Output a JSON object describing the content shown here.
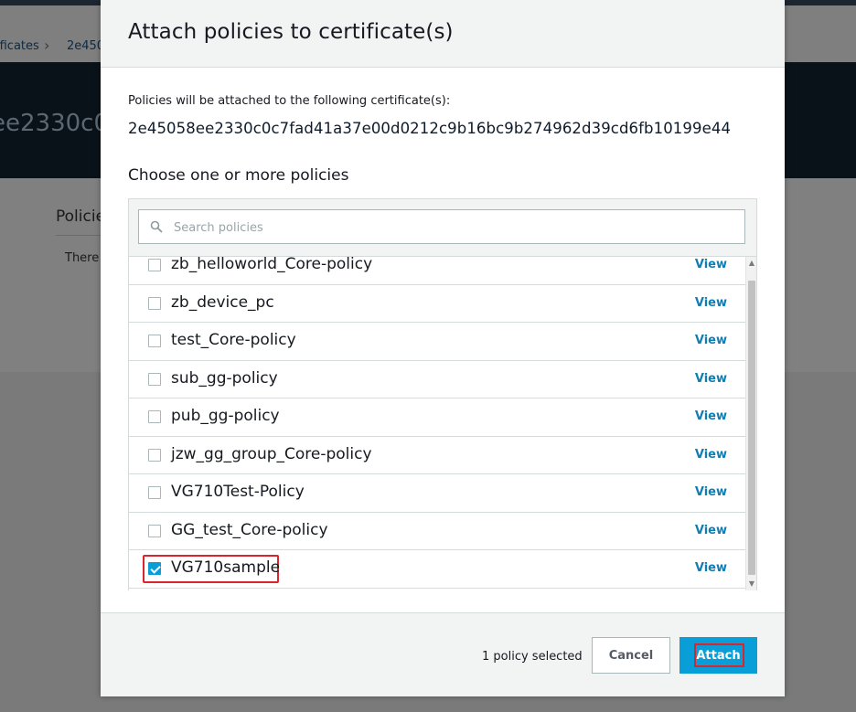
{
  "background": {
    "breadcrumb": [
      "ificates",
      "2e450"
    ],
    "banner_title": "ee2330c0c",
    "section_title": "Policie",
    "section_text": "There"
  },
  "modal": {
    "title": "Attach policies to certificate(s)",
    "cert_label": "Policies will be attached to the following certificate(s):",
    "cert_id": "2e45058ee2330c0c7fad41a37e00d0212c9b16bc9b274962d39cd6fb10199e44",
    "choose_label": "Choose one or more policies",
    "search": {
      "placeholder": "Search policies",
      "value": ""
    },
    "policies": [
      {
        "name": "zb_helloworld_Core-policy",
        "checked": false,
        "view": "View"
      },
      {
        "name": "zb_device_pc",
        "checked": false,
        "view": "View"
      },
      {
        "name": "test_Core-policy",
        "checked": false,
        "view": "View"
      },
      {
        "name": "sub_gg-policy",
        "checked": false,
        "view": "View"
      },
      {
        "name": "pub_gg-policy",
        "checked": false,
        "view": "View"
      },
      {
        "name": "jzw_gg_group_Core-policy",
        "checked": false,
        "view": "View"
      },
      {
        "name": "VG710Test-Policy",
        "checked": false,
        "view": "View"
      },
      {
        "name": "GG_test_Core-policy",
        "checked": false,
        "view": "View"
      },
      {
        "name": "VG710sample",
        "checked": true,
        "view": "View"
      }
    ],
    "footer": {
      "selected_count": "1 policy selected",
      "cancel_label": "Cancel",
      "attach_label": "Attach"
    }
  },
  "colors": {
    "accent": "#0a9ed8",
    "link": "#0f7eb3",
    "highlight": "#d9262e"
  }
}
